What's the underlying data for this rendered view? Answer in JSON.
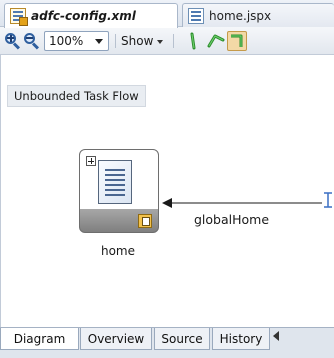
{
  "editor_tabs": [
    {
      "label": "adfc-config.xml",
      "active": true,
      "icon": "xml-config-icon"
    },
    {
      "label": "home.jspx",
      "active": false,
      "icon": "jspx-page-icon"
    }
  ],
  "toolbar": {
    "zoom_in_icon": "zoom-in-icon",
    "zoom_out_icon": "zoom-out-icon",
    "zoom_value": "100%",
    "show_label": "Show",
    "layout_buttons": [
      "vertical-layout-icon",
      "diagonal-layout-icon",
      "orthogonal-layout-icon"
    ]
  },
  "diagram": {
    "flow_label": "Unbounded Task Flow",
    "activity": {
      "name": "home",
      "type": "view"
    },
    "control_flow_case": "globalHome"
  },
  "bottom_tabs": [
    {
      "label": "Diagram",
      "active": true
    },
    {
      "label": "Overview",
      "active": false
    },
    {
      "label": "Source",
      "active": false
    },
    {
      "label": "History",
      "active": false
    }
  ],
  "colors": {
    "accent_blue": "#2f5f9e",
    "layout_green": "#3aa33a",
    "selected_button": "#f3d9a6"
  }
}
